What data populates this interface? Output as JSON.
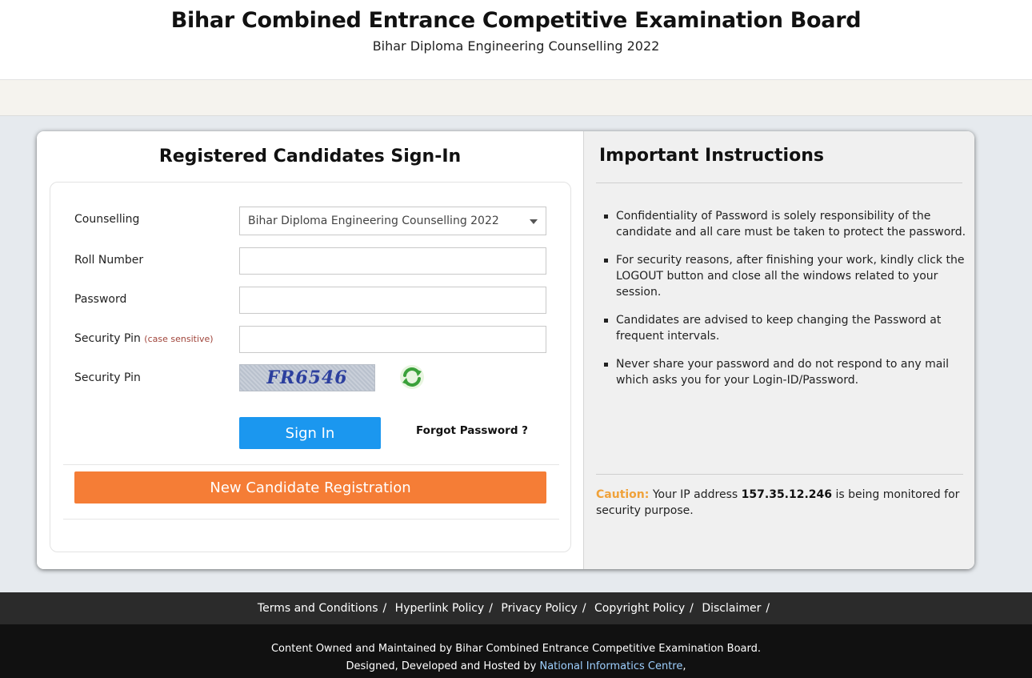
{
  "header": {
    "title": "Bihar Combined Entrance Competitive Examination Board",
    "subtitle": "Bihar Diploma Engineering Counselling 2022"
  },
  "signin": {
    "heading": "Registered Candidates Sign-In",
    "counselling_label": "Counselling",
    "counselling_value": "Bihar Diploma Engineering Counselling 2022",
    "roll_label": "Roll Number",
    "roll_value": "",
    "password_label": "Password",
    "password_value": "",
    "pin_label": "Security Pin",
    "pin_hint": "(case sensitive)",
    "pin_value": "",
    "captcha_label": "Security Pin",
    "captcha_text": "FR6546",
    "signin_button": "Sign In",
    "forgot_link": "Forgot Password ?",
    "register_button": "New Candidate Registration"
  },
  "instructions": {
    "heading": "Important Instructions",
    "items": [
      "Confidentiality of Password is solely responsibility of the candidate and all care must be taken to protect the password.",
      "For security reasons, after finishing your work, kindly click the LOGOUT button and close all the windows related to your session.",
      "Candidates are advised to keep changing the Password at frequent intervals.",
      "Never share your password and do not respond to any mail which asks you for your Login-ID/Password."
    ],
    "caution_label": "Caution:",
    "caution_prefix": "Your IP address",
    "ip": "157.35.12.246",
    "caution_suffix": "is being monitored for security purpose."
  },
  "footer": {
    "links": [
      "Terms and Conditions",
      "Hyperlink Policy",
      "Privacy Policy",
      "Copyright Policy",
      "Disclaimer"
    ],
    "separator": "/",
    "owned": "Content Owned and Maintained by Bihar Combined Entrance Competitive Examination Board.",
    "designed_prefix": "Designed, Developed and Hosted by",
    "nic": "National Informatics Centre",
    "designed_suffix": ","
  },
  "colors": {
    "signin_button": "#1b97ef",
    "register_button": "#f57d36",
    "caution": "#f0a23a",
    "footer_top": "#2b2b2b",
    "footer_bottom": "#111111"
  },
  "icons": {
    "dropdown": "chevron-down-icon",
    "refresh": "refresh-icon"
  }
}
